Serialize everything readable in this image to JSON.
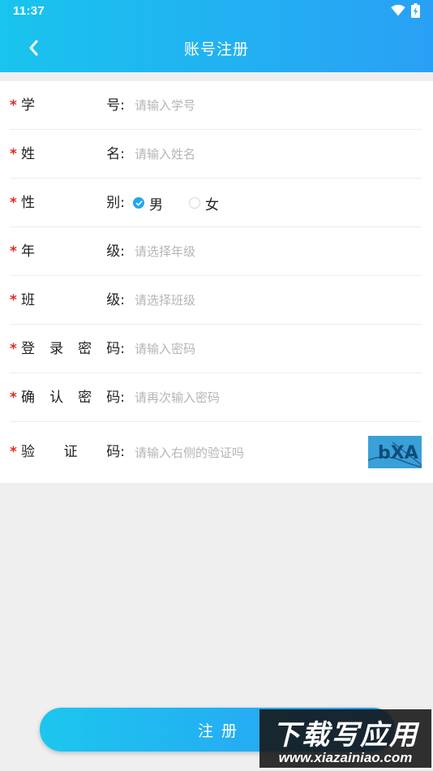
{
  "status_bar": {
    "time": "11:37"
  },
  "header": {
    "title": "账号注册"
  },
  "form": {
    "student_id": {
      "label_chars": [
        "学",
        "号:"
      ],
      "placeholder": "请输入学号"
    },
    "name": {
      "label_chars": [
        "姓",
        "名:"
      ],
      "placeholder": "请输入姓名"
    },
    "gender": {
      "label_chars": [
        "性",
        "别:"
      ],
      "options": [
        {
          "label": "男",
          "checked": true
        },
        {
          "label": "女",
          "checked": false
        }
      ]
    },
    "grade": {
      "label_chars": [
        "年",
        "级:"
      ],
      "placeholder": "请选择年级"
    },
    "class": {
      "label_chars": [
        "班",
        "级:"
      ],
      "placeholder": "请选择班级"
    },
    "password": {
      "label_chars": [
        "登",
        "录",
        "密",
        "码:"
      ],
      "placeholder": "请输入密码"
    },
    "confirm_password": {
      "label_chars": [
        "确",
        "认",
        "密",
        "码:"
      ],
      "placeholder": "请再次输入密码"
    },
    "captcha": {
      "label_chars": [
        "验",
        "证",
        "码:"
      ],
      "placeholder": "请输入右侧的验证吗",
      "image_text": "bXA"
    },
    "required_mark": "*"
  },
  "register_button": {
    "label": "注册"
  },
  "watermark": {
    "main": "下载写应用",
    "sub": "www.xiazainiao.com"
  },
  "colors": {
    "header_start": "#19c4ee",
    "header_end": "#2aa0f5",
    "required": "#e8261f",
    "radio_checked": "#24a6ee",
    "placeholder": "#b5b5b5"
  }
}
